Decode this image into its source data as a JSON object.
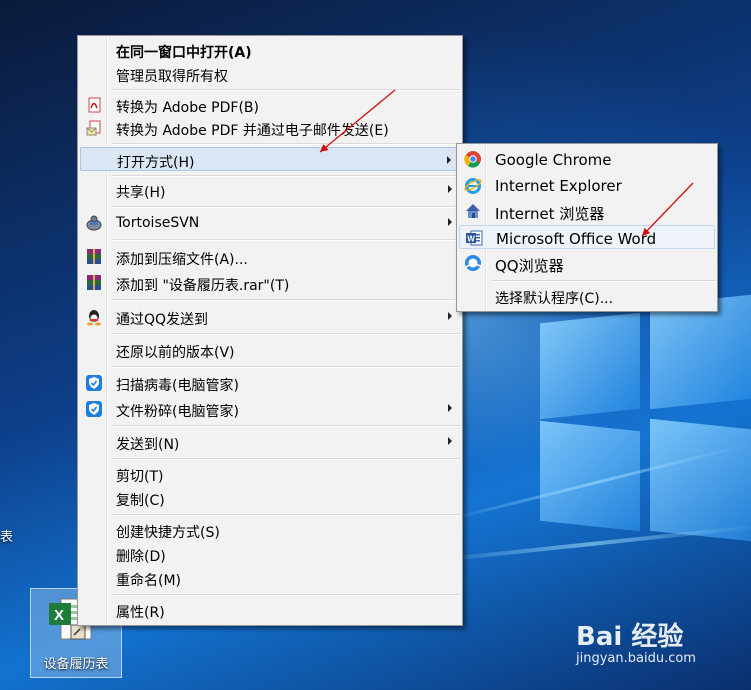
{
  "desktop": {
    "partial_label": "表",
    "file_icon_label": "设备履历表"
  },
  "main_menu": {
    "items": [
      {
        "label": "在同一窗口中打开(A)",
        "icon": null,
        "bold": true
      },
      {
        "label": "管理员取得所有权",
        "icon": null
      },
      {
        "label": "转换为 Adobe PDF(B)",
        "icon": "pdf-icon"
      },
      {
        "label": "转换为 Adobe PDF 并通过电子邮件发送(E)",
        "icon": "pdf-mail-icon"
      },
      {
        "label": "打开方式(H)",
        "icon": null,
        "submenu": true,
        "highlighted": true
      },
      {
        "label": "共享(H)",
        "icon": null,
        "submenu": true
      },
      {
        "label": "TortoiseSVN",
        "icon": "tortoise-icon",
        "submenu": true
      },
      {
        "label": "添加到压缩文件(A)...",
        "icon": "winrar-icon"
      },
      {
        "label": "添加到 \"设备履历表.rar\"(T)",
        "icon": "winrar-icon"
      },
      {
        "label": "通过QQ发送到",
        "icon": "qq-icon",
        "submenu": true
      },
      {
        "label": "还原以前的版本(V)",
        "icon": null
      },
      {
        "label": "扫描病毒(电脑管家)",
        "icon": "guard-icon"
      },
      {
        "label": "文件粉碎(电脑管家)",
        "icon": "guard-icon",
        "submenu": true
      },
      {
        "label": "发送到(N)",
        "icon": null,
        "submenu": true
      },
      {
        "label": "剪切(T)",
        "icon": null
      },
      {
        "label": "复制(C)",
        "icon": null
      },
      {
        "label": "创建快捷方式(S)",
        "icon": null
      },
      {
        "label": "删除(D)",
        "icon": null
      },
      {
        "label": "重命名(M)",
        "icon": null
      },
      {
        "label": "属性(R)",
        "icon": null
      }
    ]
  },
  "sub_menu": {
    "items": [
      {
        "label": "Google Chrome",
        "icon": "chrome-icon"
      },
      {
        "label": "Internet Explorer",
        "icon": "ie-icon"
      },
      {
        "label": "Internet 浏览器",
        "icon": "browser-house-icon"
      },
      {
        "label": "Microsoft Office Word",
        "icon": "word-icon",
        "highlighted": true
      },
      {
        "label": "QQ浏览器",
        "icon": "qq-browser-icon"
      },
      {
        "label": "选择默认程序(C)...",
        "icon": null
      }
    ]
  },
  "watermark": {
    "main": "Bai 经验",
    "sub": "jingyan.baidu.com"
  },
  "colors": {
    "menu_bg": "#f2f2f2",
    "highlight": "#dbe6f4",
    "arrow_annotation": "#d01010"
  }
}
